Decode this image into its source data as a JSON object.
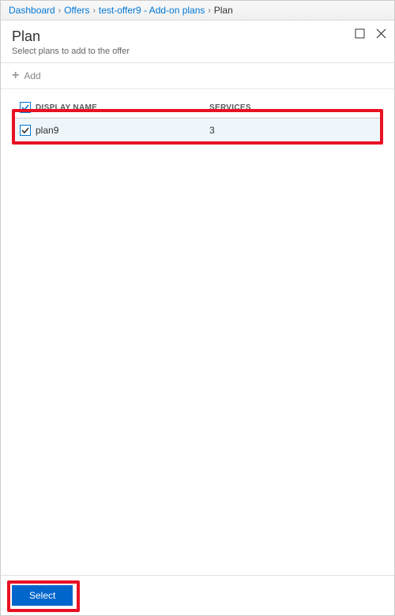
{
  "breadcrumb": {
    "items": [
      "Dashboard",
      "Offers",
      "test-offer9 - Add-on plans"
    ],
    "current": "Plan"
  },
  "header": {
    "title": "Plan",
    "subtitle": "Select plans to add to the offer"
  },
  "toolbar": {
    "add_label": "Add"
  },
  "table": {
    "columns": {
      "name": "DISPLAY NAME",
      "services": "SERVICES"
    },
    "rows": [
      {
        "checked": true,
        "name": "plan9",
        "services": "3"
      }
    ]
  },
  "footer": {
    "select_label": "Select"
  }
}
